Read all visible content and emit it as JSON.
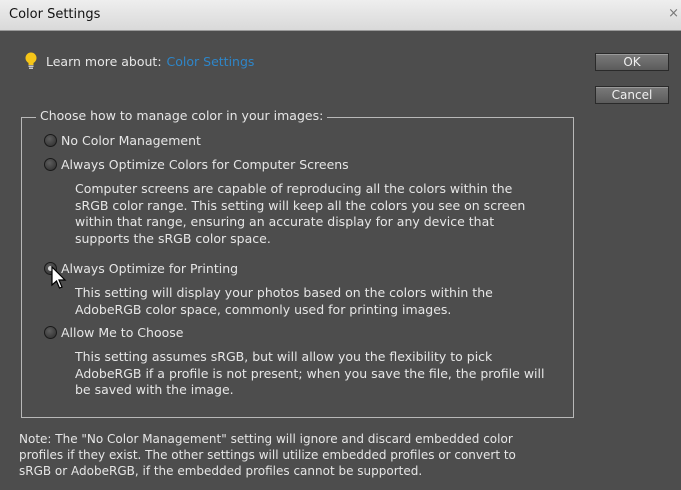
{
  "window": {
    "title": "Color Settings",
    "close_label": "×"
  },
  "learn_more": {
    "label": "Learn more about:",
    "link": "Color Settings"
  },
  "buttons": {
    "ok": "OK",
    "cancel": "Cancel"
  },
  "group": {
    "legend": "Choose how to manage color in your images:",
    "options": [
      {
        "label": "No Color Management",
        "checked": false
      },
      {
        "label": "Always Optimize Colors for Computer Screens",
        "checked": false,
        "description": "Computer screens are capable of reproducing all the colors within the\nsRGB color range. This setting will keep all the colors you see on screen\nwithin that range, ensuring an accurate display for any device that\nsupports the sRGB color space."
      },
      {
        "label": "Always Optimize for Printing",
        "checked": true,
        "description": "This setting will display your photos based on the colors within the\nAdobeRGB color space, commonly used for printing images."
      },
      {
        "label": "Allow Me to Choose",
        "checked": false,
        "description": "This setting assumes sRGB, but will allow you the flexibility to pick\nAdobeRGB if a profile is not present; when you save the file, the profile will\nbe saved with the image."
      }
    ]
  },
  "note": "Note: The \"No Color Management\" setting will ignore and discard embedded color\nprofiles if they exist. The other settings will utilize embedded profiles or convert to\nsRGB or AdobeRGB, if the embedded profiles cannot be supported.",
  "colors": {
    "background": "#4d4d4d",
    "link": "#2e86c9",
    "text": "#e6e6e6",
    "bulb": "#f5c518"
  },
  "icons": {
    "learn_more": "lightbulb-icon",
    "pointer": "mouse-cursor-icon"
  }
}
